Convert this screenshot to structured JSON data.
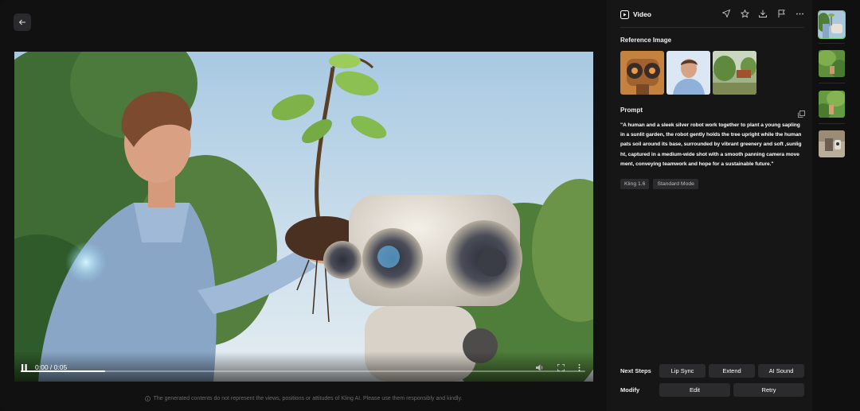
{
  "header": {
    "title": "Video",
    "actions": [
      "send-icon",
      "star-icon",
      "download-icon",
      "flag-icon",
      "more-icon"
    ]
  },
  "player": {
    "time": "0:00 / 0:05",
    "progress_fraction": 0.15
  },
  "disclaimer": "The generated contents do not represent the views, positions or attitudes of Kling AI. Please use them responsibly and kindly.",
  "reference": {
    "title": "Reference Image",
    "images": [
      "robot-portrait",
      "man-portrait",
      "garden-scene"
    ]
  },
  "prompt": {
    "title": "Prompt",
    "lines": [
      "\"A human and a sleek silver robot work together to plant a young sapling",
      "in a sunlit garden, the robot gently holds the tree upright while the human",
      "pats soil around its base, surrounded by vibrant greenery and soft ,sunlig",
      "ht, captured in a medium-wide shot with a smooth panning camera move",
      "ment, conveying teamwork and hope for a sustainable future.\""
    ]
  },
  "tags": [
    "Kling 1.6",
    "Standard Mode"
  ],
  "next_steps": {
    "label": "Next Steps",
    "buttons": [
      "Lip Sync",
      "Extend",
      "AI Sound"
    ]
  },
  "modify": {
    "label": "Modify",
    "buttons": [
      "Edit",
      "Retry"
    ]
  },
  "colors": {
    "accent": "#6fd16a",
    "panel": "#161617",
    "button": "#2b2b2d"
  }
}
